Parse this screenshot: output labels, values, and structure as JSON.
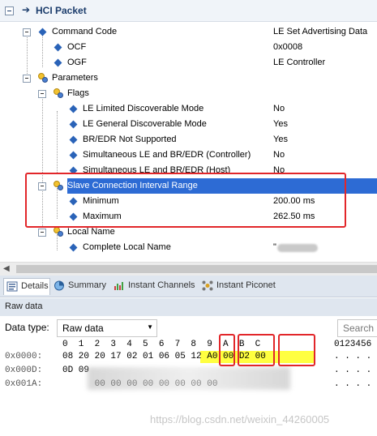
{
  "header": {
    "title": "HCI Packet"
  },
  "tree": [
    {
      "label": "Command Code",
      "value": "LE Set Advertising Data"
    },
    {
      "label": "OCF",
      "value": "0x0008"
    },
    {
      "label": "OGF",
      "value": "LE Controller"
    },
    {
      "label": "Parameters",
      "value": ""
    },
    {
      "label": "Flags",
      "value": ""
    },
    {
      "label": "LE Limited Discoverable Mode",
      "value": "No"
    },
    {
      "label": "LE General Discoverable Mode",
      "value": "Yes"
    },
    {
      "label": "BR/EDR Not Supported",
      "value": "Yes"
    },
    {
      "label": "Simultaneous LE and BR/EDR (Controller)",
      "value": "No"
    },
    {
      "label": "Simultaneous LE and BR/EDR (Host)",
      "value": "No"
    },
    {
      "label": "Slave Connection Interval Range",
      "value": ""
    },
    {
      "label": "Minimum",
      "value": "200.00 ms"
    },
    {
      "label": "Maximum",
      "value": "262.50 ms"
    },
    {
      "label": "Local Name",
      "value": ""
    },
    {
      "label": "Complete Local Name",
      "value": "\""
    }
  ],
  "tabs": [
    "Details",
    "Summary",
    "Instant Channels",
    "Instant Piconet"
  ],
  "raw": {
    "section_title": "Raw data",
    "data_type_label": "Data type:",
    "data_type_value": "Raw data",
    "search_placeholder": "Search",
    "col_header": "0  1  2  3  4  5  6  7  8  9  A  B  C",
    "ascii_header": "0123456",
    "rows": [
      {
        "addr": "0x0000:",
        "hex": "08 20 20 17 02 01 06 05 12 A0 00 D2 00",
        "ascii": ". . . ."
      },
      {
        "addr": "0x000D:",
        "hex": "0D 09",
        "ascii": ". . . ."
      },
      {
        "addr": "0x001A:",
        "hex": "      00 00 00 00 00 00 00 00",
        "ascii": ". . . ."
      }
    ]
  },
  "watermark": "https://blog.csdn.net/weixin_44260005",
  "colors": {
    "selection": "#2d6bd4",
    "highlight": "#ffff40",
    "annotation": "#e2262a"
  }
}
